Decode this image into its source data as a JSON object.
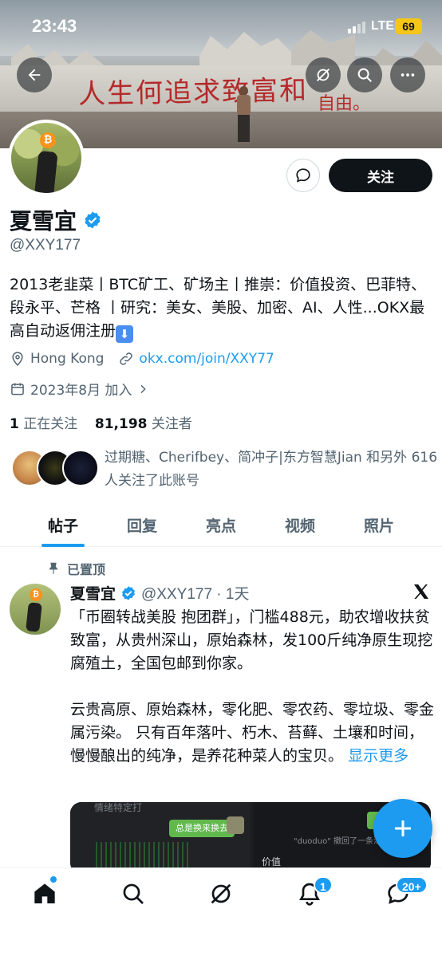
{
  "status_bar": {
    "time": "23:43",
    "network": "LTE",
    "battery": "69"
  },
  "banner": {
    "graffiti_text": "人生何追求致富和",
    "graffiti_tail": "自由。"
  },
  "actions": {
    "follow_label": "关注"
  },
  "profile": {
    "name": "夏雪宜",
    "handle": "@XXY177",
    "bio": "2013老韭菜丨BTC矿工、矿场主丨推崇：价值投资、巴菲特、段永平、芒格 丨研究：美女、美股、加密、AI、人性...OKX最高自动返佣注册",
    "bio_emoji": "⬇",
    "location": "Hong Kong",
    "website": "okx.com/join/XXY77",
    "joined": "2023年8月 加入",
    "following_count": "1",
    "following_label": "正在关注",
    "followers_count": "81,198",
    "followers_label": "关注者",
    "followed_by": "过期糖、Cherifbey、简冲子|东方智慧Jian 和另外 616 人关注了此账号"
  },
  "tabs": [
    {
      "label": "帖子",
      "active": true
    },
    {
      "label": "回复",
      "active": false
    },
    {
      "label": "亮点",
      "active": false
    },
    {
      "label": "视频",
      "active": false
    },
    {
      "label": "照片",
      "active": false
    }
  ],
  "post": {
    "pinned_label": "已置顶",
    "author_name": "夏雪宜",
    "author_meta": "@XXY177 · 1天",
    "paragraph1": "「币圈转战美股 抱团群」，门槛488元，助农增收扶贫致富，从贵州深山，原始森林，发100斤纯净原生现挖腐殖土，全国包邮到你家。",
    "paragraph2": "云贵高原、原始森林，零化肥、零农药、零垃圾、零金属污染。 只有百年落叶、朽木、苔藓、土壤和时间，慢慢酿出的纯净，是养花种菜人的宝贝。",
    "show_more": "显示更多",
    "media": {
      "left_top_text": "情绪特定打",
      "chat_bubble": "总是换来换去",
      "right_text": "\"duoduo\" 撤回了一条消息",
      "right_value": "价值"
    }
  },
  "bottom_nav": {
    "notifications_badge": "1",
    "messages_badge": "20+"
  },
  "colors": {
    "accent": "#1d9bf0",
    "text": "#0f1419",
    "secondary": "#536471",
    "bitcoin": "#f7931a"
  }
}
